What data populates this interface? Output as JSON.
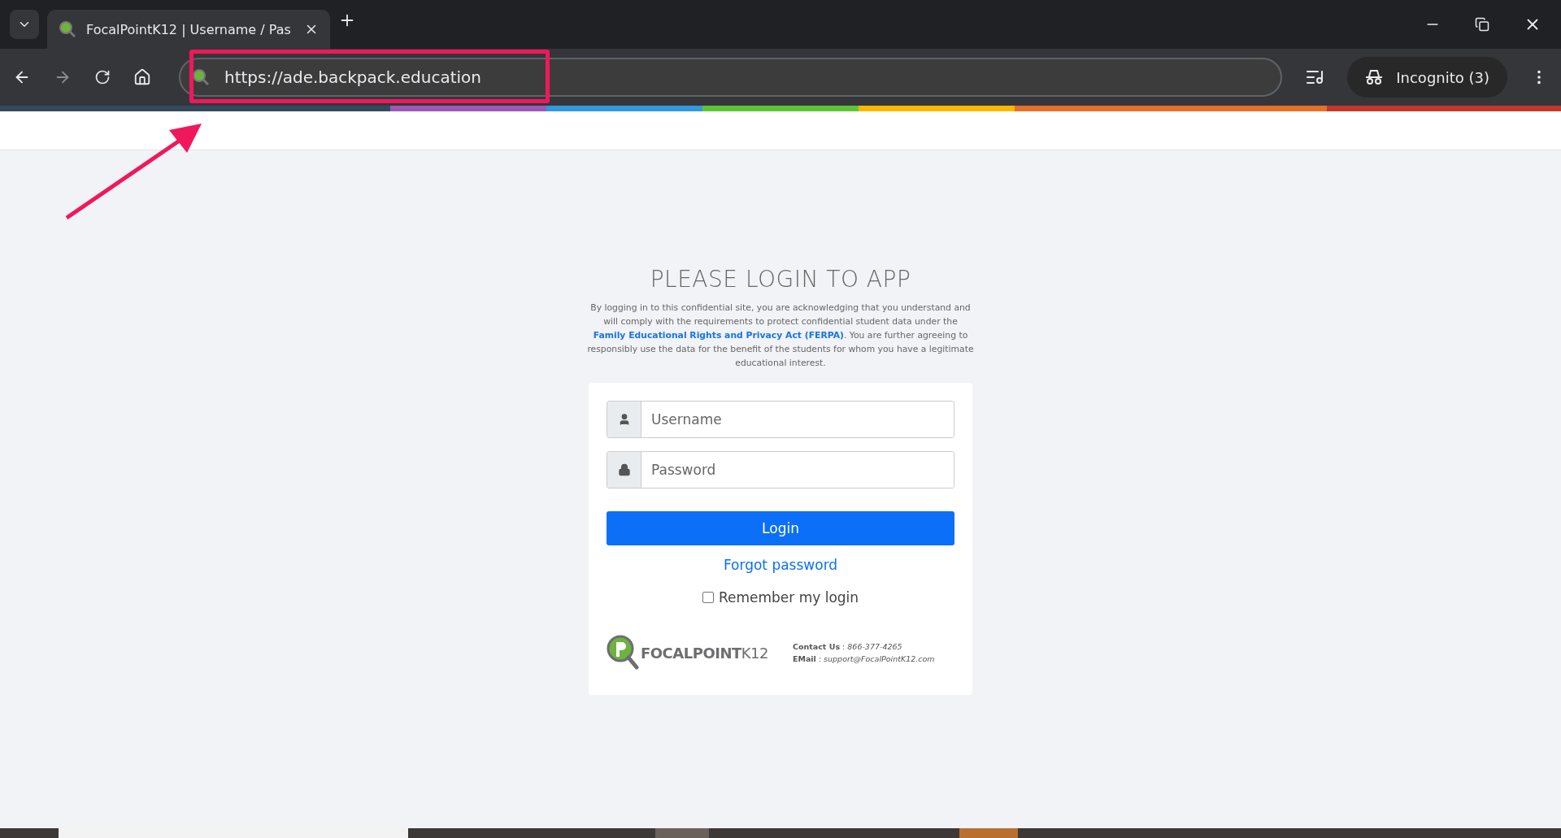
{
  "browser": {
    "tab": {
      "title": "FocalPointK12 | Username / Pas",
      "selected": true
    },
    "url": "https://ade.backpack.education",
    "profile": "Incognito (3)"
  },
  "login": {
    "heading": "PLEASE LOGIN TO APP",
    "notice": {
      "before": "By logging in to this confidential site, you are acknowledging that you understand and will comply with the requirements to protect confidential student data under the",
      "link": "Family Educational Rights and Privacy Act (FERPA)",
      "after": ". You are further agreeing to responsibly use the data for the benefit of the students for whom you have a legitimate educational interest."
    },
    "fields": [
      {
        "kind": "user",
        "placeholder": "Username"
      },
      {
        "kind": "password",
        "placeholder": "Password"
      }
    ],
    "submit": "Login",
    "forgot": "Forgot password",
    "remember": {
      "label": "Remember my login",
      "checked": false
    },
    "logo": {
      "bold": "FOCALPOINT",
      "light": "K12"
    },
    "contact": [
      {
        "label": "Contact Us",
        "sep": ":",
        "value": "866-377-4265"
      },
      {
        "label": "EMail",
        "sep": ":",
        "value": "support@FocalPointK12.com"
      }
    ]
  }
}
